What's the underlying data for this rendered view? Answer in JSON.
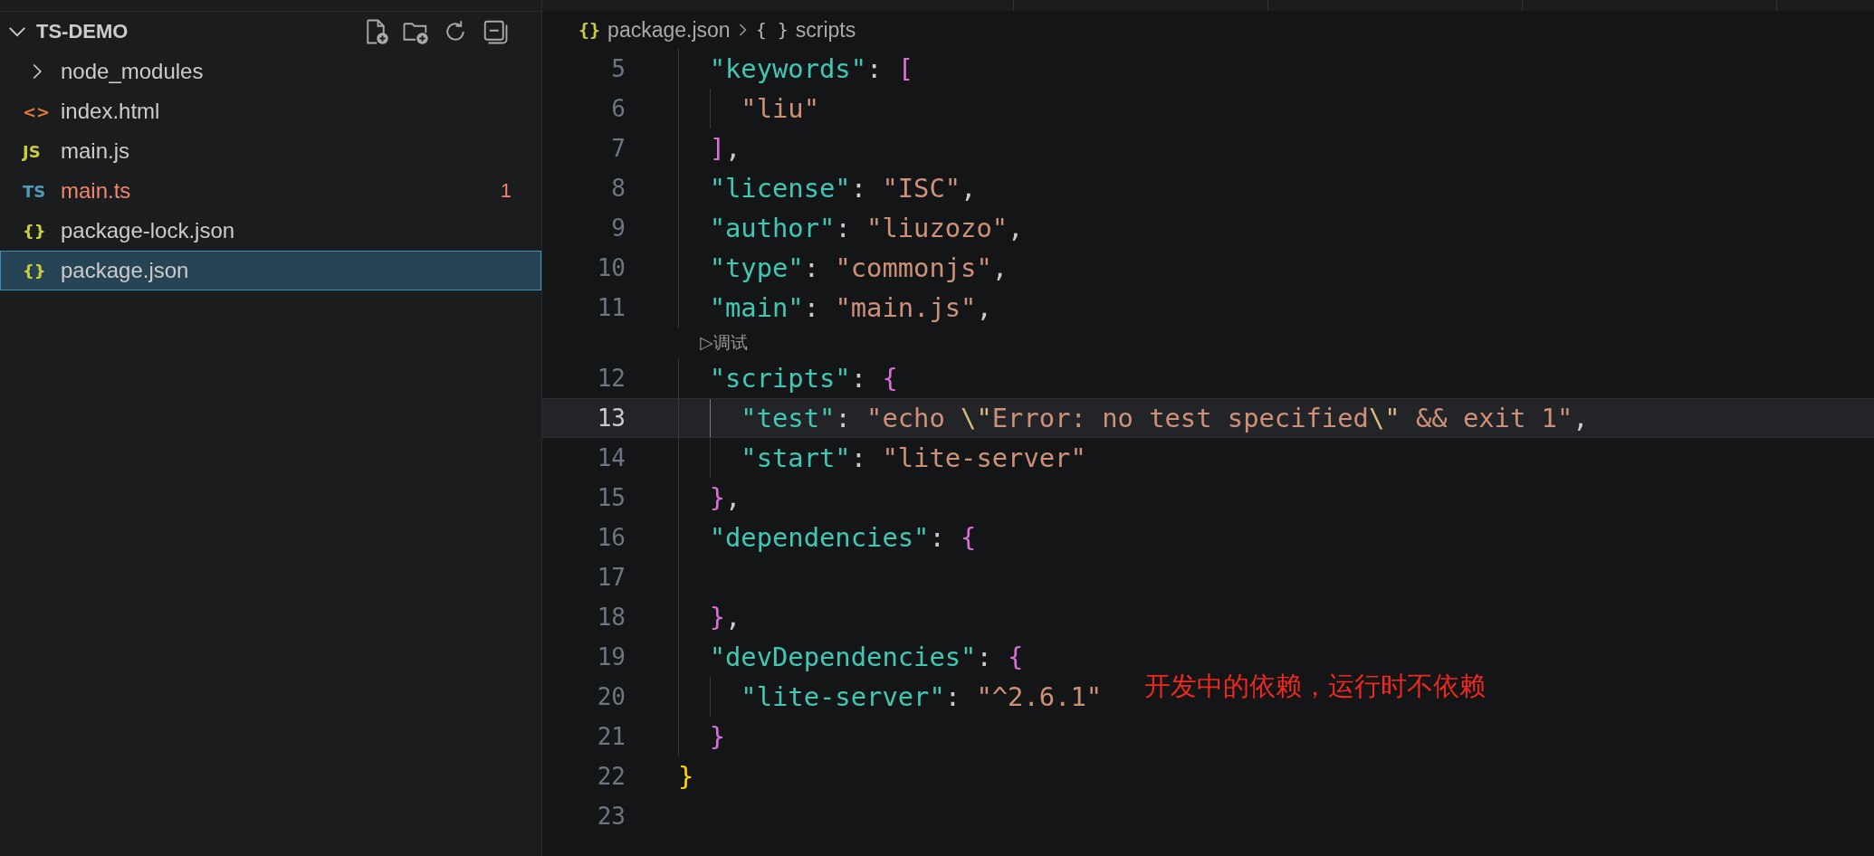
{
  "explorer": {
    "title": "TS-DEMO",
    "expanded": true,
    "items": [
      {
        "kind": "folder",
        "name": "node_modules",
        "expanded": false,
        "selected": false
      },
      {
        "kind": "file",
        "badge": "<>",
        "color": "#e37933",
        "name": "index.html",
        "selected": false
      },
      {
        "kind": "file",
        "badge": "JS",
        "color": "#cbcb41",
        "name": "main.js",
        "selected": false
      },
      {
        "kind": "file",
        "badge": "TS",
        "color": "#519aba",
        "name": "main.ts",
        "problems": "1",
        "selected": false
      },
      {
        "kind": "file",
        "badge": "{}",
        "color": "#cbcb41",
        "name": "package-lock.json",
        "selected": false
      },
      {
        "kind": "file",
        "badge": "{}",
        "color": "#cbcb41",
        "name": "package.json",
        "selected": true
      }
    ]
  },
  "breadcrumb": [
    {
      "icon": "{}",
      "label": "package.json"
    },
    {
      "icon": "{ }",
      "label": "scripts"
    }
  ],
  "code_lines": [
    {
      "kind": "group",
      "children": [
        {
          "kind": "code",
          "number": "5",
          "current": false,
          "tokens": [
            {
              "kind": "key",
              "text": "\"keywords\""
            },
            {
              "kind": "punct",
              "text": ": "
            },
            {
              "kind": "bracket",
              "text": "["
            }
          ],
          "children": [
            {
              "kind": "code",
              "number": "6",
              "current": false,
              "tokens": [
                {
                  "kind": "string",
                  "text": "\"liu\""
                }
              ]
            }
          ]
        },
        {
          "kind": "code",
          "number": "7",
          "current": false,
          "tokens": [
            {
              "kind": "bracket",
              "text": "]"
            },
            {
              "kind": "punct",
              "text": ","
            }
          ]
        },
        {
          "kind": "code",
          "number": "8",
          "current": false,
          "tokens": [
            {
              "kind": "key",
              "text": "\"license\""
            },
            {
              "kind": "punct",
              "text": ": "
            },
            {
              "kind": "string",
              "text": "\"ISC\""
            },
            {
              "kind": "punct",
              "text": ","
            }
          ]
        },
        {
          "kind": "code",
          "number": "9",
          "current": false,
          "tokens": [
            {
              "kind": "key",
              "text": "\"author\""
            },
            {
              "kind": "punct",
              "text": ": "
            },
            {
              "kind": "string",
              "text": "\"liuzozo\""
            },
            {
              "kind": "punct",
              "text": ","
            }
          ]
        },
        {
          "kind": "code",
          "number": "10",
          "current": false,
          "tokens": [
            {
              "kind": "key",
              "text": "\"type\""
            },
            {
              "kind": "punct",
              "text": ": "
            },
            {
              "kind": "string",
              "text": "\"commonjs\""
            },
            {
              "kind": "punct",
              "text": ","
            }
          ]
        },
        {
          "kind": "code",
          "number": "11",
          "current": false,
          "tokens": [
            {
              "kind": "key",
              "text": "\"main\""
            },
            {
              "kind": "punct",
              "text": ": "
            },
            {
              "kind": "string",
              "text": "\"main.js\""
            },
            {
              "kind": "punct",
              "text": ","
            }
          ]
        },
        {
          "kind": "codelens",
          "text": "▷调试"
        },
        {
          "kind": "code",
          "number": "12",
          "current": false,
          "tokens": [
            {
              "kind": "key",
              "text": "\"scripts\""
            },
            {
              "kind": "punct",
              "text": ": "
            },
            {
              "kind": "bracket",
              "text": "{"
            }
          ],
          "children": [
            {
              "kind": "code",
              "number": "13",
              "current": true,
              "tokens": [
                {
                  "kind": "key",
                  "text": "\"test\""
                },
                {
                  "kind": "punct",
                  "text": ": "
                },
                {
                  "kind": "string",
                  "text": "\"echo "
                },
                {
                  "kind": "escape",
                  "text": "\\\""
                },
                {
                  "kind": "string",
                  "text": "Error: no test specified"
                },
                {
                  "kind": "escape",
                  "text": "\\\""
                },
                {
                  "kind": "string",
                  "text": " && exit 1\""
                },
                {
                  "kind": "punct",
                  "text": ","
                }
              ]
            },
            {
              "kind": "code",
              "number": "14",
              "current": false,
              "tokens": [
                {
                  "kind": "key",
                  "text": "\"start\""
                },
                {
                  "kind": "punct",
                  "text": ": "
                },
                {
                  "kind": "string",
                  "text": "\"lite-server\""
                }
              ]
            }
          ]
        },
        {
          "kind": "code",
          "number": "15",
          "current": false,
          "tokens": [
            {
              "kind": "bracket",
              "text": "}"
            },
            {
              "kind": "punct",
              "text": ","
            }
          ]
        },
        {
          "kind": "code",
          "number": "16",
          "current": false,
          "tokens": [
            {
              "kind": "key",
              "text": "\"dependencies\""
            },
            {
              "kind": "punct",
              "text": ": "
            },
            {
              "kind": "bracket",
              "text": "{"
            }
          ]
        },
        {
          "kind": "code",
          "number": "17",
          "current": false
        },
        {
          "kind": "code",
          "number": "18",
          "current": false,
          "tokens": [
            {
              "kind": "bracket",
              "text": "}"
            },
            {
              "kind": "punct",
              "text": ","
            }
          ]
        },
        {
          "kind": "code",
          "number": "19",
          "current": false,
          "tokens": [
            {
              "kind": "key",
              "text": "\"devDependencies\""
            },
            {
              "kind": "punct",
              "text": ": "
            },
            {
              "kind": "bracket",
              "text": "{"
            }
          ],
          "children": [
            {
              "kind": "code",
              "number": "20",
              "current": false,
              "tokens": [
                {
                  "kind": "key",
                  "text": "\"lite-server\""
                },
                {
                  "kind": "punct",
                  "text": ": "
                },
                {
                  "kind": "string",
                  "text": "\"^2.6.1\""
                }
              ]
            }
          ]
        },
        {
          "kind": "code",
          "number": "21",
          "current": false,
          "tokens": [
            {
              "kind": "bracket",
              "text": "}"
            }
          ]
        }
      ]
    },
    {
      "kind": "code",
      "number": "22",
      "current": false,
      "tokens": [
        {
          "kind": "root",
          "text": "}"
        }
      ]
    },
    {
      "kind": "code",
      "number": "23",
      "current": false
    }
  ],
  "annotation": "开发中的依赖，运行时不依赖"
}
